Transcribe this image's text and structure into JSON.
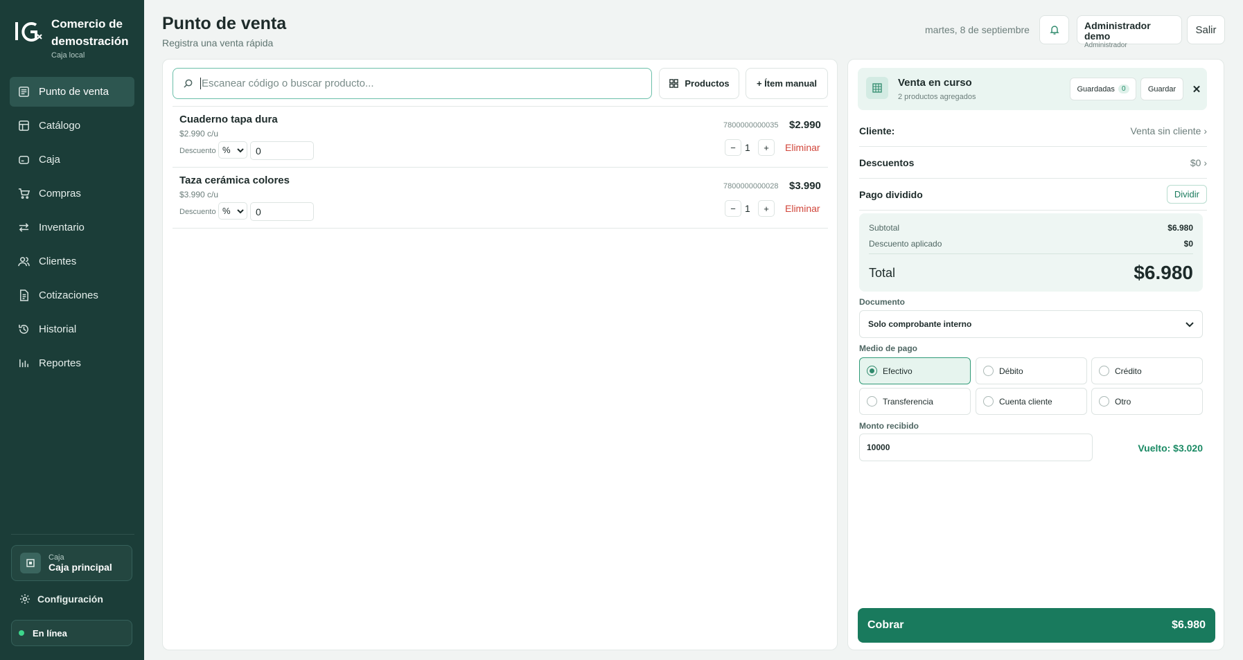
{
  "brand": {
    "title": "Comercio de demostración",
    "subtitle": "Caja local"
  },
  "sidebar": {
    "items": [
      {
        "label": "Punto de venta",
        "icon": "receipt-icon",
        "active": true
      },
      {
        "label": "Catálogo",
        "icon": "catalog-icon"
      },
      {
        "label": "Caja",
        "icon": "cash-register-icon"
      },
      {
        "label": "Compras",
        "icon": "cart-icon"
      },
      {
        "label": "Inventario",
        "icon": "arrows-swap-icon"
      },
      {
        "label": "Clientes",
        "icon": "users-icon"
      },
      {
        "label": "Cotizaciones",
        "icon": "document-icon"
      },
      {
        "label": "Historial",
        "icon": "history-icon"
      },
      {
        "label": "Reportes",
        "icon": "bar-chart-icon"
      }
    ],
    "register": {
      "small": "Caja",
      "name": "Caja principal"
    },
    "settings_label": "Configuración",
    "status_label": "En línea"
  },
  "header": {
    "title": "Punto de venta",
    "subtitle": "Registra una venta rápida",
    "date": "martes, 8 de septiembre",
    "user_name": "Administrador demo",
    "user_role": "Administrador",
    "logout_label": "Salir"
  },
  "search": {
    "placeholder": "Escanear código o buscar producto..."
  },
  "toolbar": {
    "products_label": "Productos",
    "manual_label": "+ Ítem manual"
  },
  "cart_items": [
    {
      "name": "Cuaderno tapa dura",
      "unit_price": "$2.990 c/u",
      "discount_label": "Descuento",
      "discount_type": "%",
      "discount_value": "0",
      "code": "7800000000035",
      "price": "$2.990",
      "qty": "1",
      "remove_label": "Eliminar"
    },
    {
      "name": "Taza cerámica colores",
      "unit_price": "$3.990 c/u",
      "discount_label": "Descuento",
      "discount_type": "%",
      "discount_value": "0",
      "code": "7800000000028",
      "price": "$3.990",
      "qty": "1",
      "remove_label": "Eliminar"
    }
  ],
  "sale": {
    "title": "Venta en curso",
    "subtitle": "2 productos agregados",
    "saved_label": "Guardadas",
    "saved_count": "0",
    "save_label": "Guardar",
    "close_symbol": "✕",
    "client_label": "Cliente:",
    "client_value": "Venta sin cliente",
    "discounts_label": "Descuentos",
    "discounts_value": "$0",
    "split_label": "Pago dividido",
    "split_button": "Dividir",
    "subtotal_label": "Subtotal",
    "subtotal_value": "$6.980",
    "discount_applied_label": "Descuento aplicado",
    "discount_applied_value": "$0",
    "total_label": "Total",
    "total_value": "$6.980",
    "document_label": "Documento",
    "document_value": "Solo comprobante interno",
    "payment_label": "Medio de pago",
    "payment_methods": [
      {
        "label": "Efectivo",
        "selected": true
      },
      {
        "label": "Débito"
      },
      {
        "label": "Crédito"
      },
      {
        "label": "Transferencia"
      },
      {
        "label": "Cuenta cliente"
      },
      {
        "label": "Otro"
      }
    ],
    "amount_label": "Monto recibido",
    "amount_value": "10000",
    "change": "Vuelto: $3.020",
    "charge_label": "Cobrar",
    "charge_value": "$6.980"
  },
  "colors": {
    "sidebar": "#1b3d38",
    "accent": "#197a5d",
    "danger": "#d1463b"
  }
}
